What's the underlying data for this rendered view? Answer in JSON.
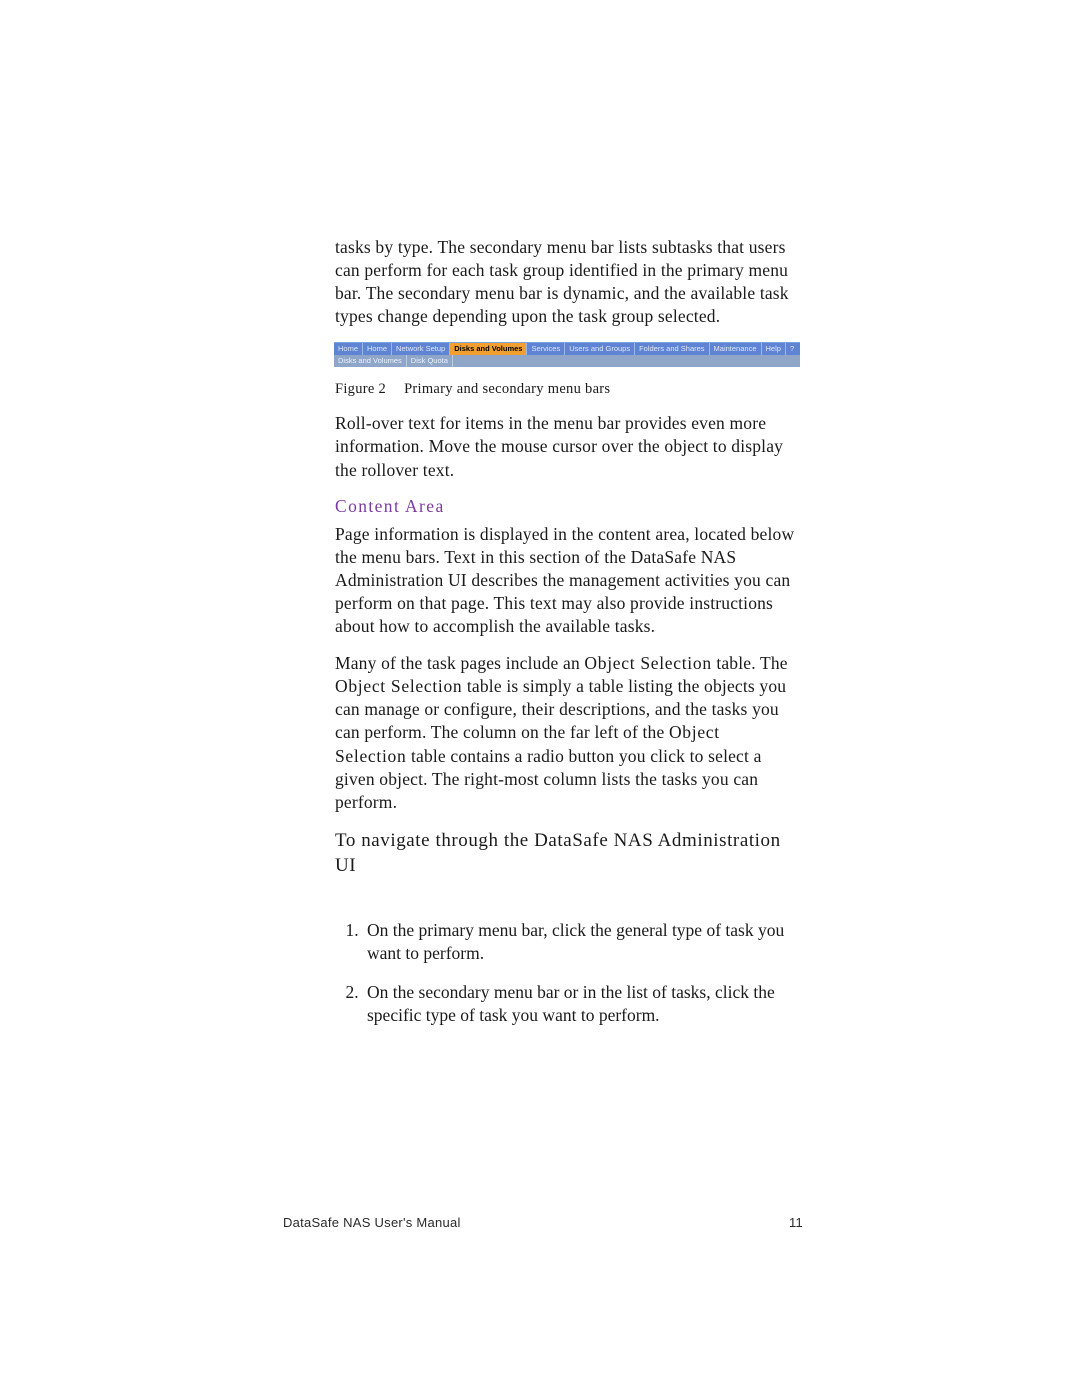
{
  "para_intro": "tasks by type. The secondary menu bar lists subtasks that users can perform for each task group identified in the primary menu bar. The secondary menu bar is dynamic, and the available task types change depending upon the task group selected.",
  "menubar": {
    "primary": [
      "Home",
      "Home",
      "Network Setup",
      "Disks and Volumes",
      "Services",
      "Users and Groups",
      "Folders and Shares",
      "Maintenance",
      "Help",
      "?"
    ],
    "primary_active_index": 3,
    "secondary": [
      "Disks and Volumes",
      "Disk Quota"
    ]
  },
  "caption": {
    "prefix": "Figure 2",
    "text": "Primary and secondary menu bars"
  },
  "para_rollover": "Roll-over text for items in the menu bar provides even more information. Move the mouse cursor over the object to display the rollover text.",
  "section_head": "Content Area",
  "para_content1": "Page information is displayed in the content area, located below the menu bars. Text in this section of the DataSafe NAS Administration UI describes the management activities you can perform on that page. This text may also provide instructions about how to accomplish the available tasks.",
  "objsel": {
    "s1": "Many of the task pages include an ",
    "os1": "Object Selection",
    "s2": " table. The ",
    "os2": "Object Selection",
    "s3": " table is simply a table listing the objects you can manage or configure, their descriptions, and the tasks you can perform. The column on the far left of the ",
    "os3": "Object Selection",
    "s4": " table contains a radio button you click to select a given object. The right-most column lists the tasks you can perform."
  },
  "subhead": "To navigate through the DataSafe NAS Administration UI",
  "steps": [
    "On the primary menu bar, click the general type of task you want to perform.",
    "On the secondary menu bar or in the list of tasks, click the specific type of task you want to perform."
  ],
  "footer": {
    "doc": "DataSafe NAS User's Manual",
    "page": "11"
  }
}
